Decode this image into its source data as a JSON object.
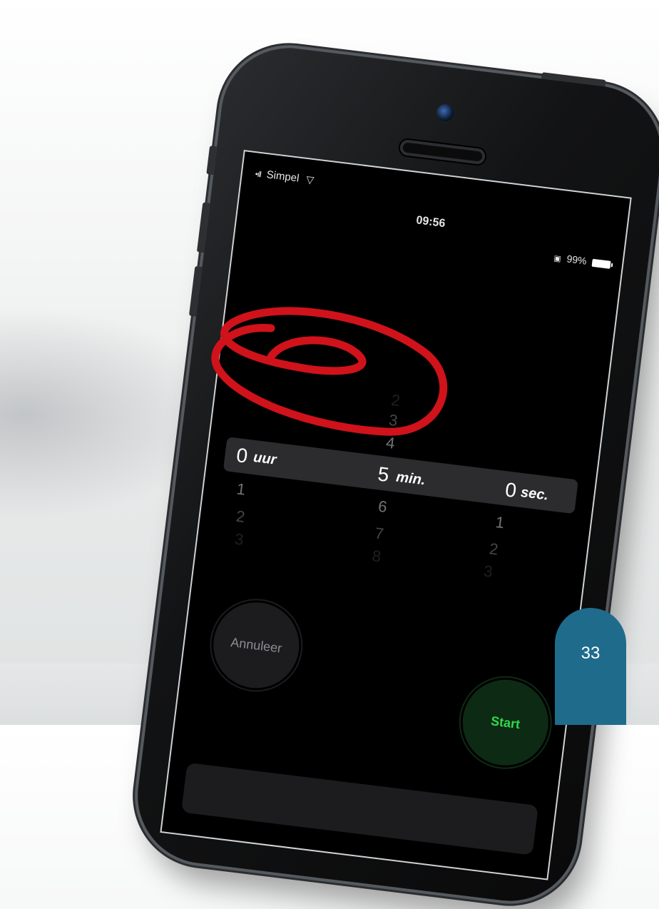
{
  "status_bar": {
    "carrier": "Simpel",
    "time": "09:56",
    "battery": "99%"
  },
  "timer_picker": {
    "hours": {
      "above": [],
      "selected": "0",
      "unit": "uur",
      "below": [
        "1",
        "2",
        "3"
      ]
    },
    "minutes": {
      "above": [
        "2",
        "3",
        "4"
      ],
      "selected": "5",
      "unit": "min.",
      "below": [
        "6",
        "7",
        "8"
      ]
    },
    "seconds": {
      "above": [],
      "selected": "0",
      "unit": "sec.",
      "below": [
        "1",
        "2",
        "3"
      ]
    }
  },
  "buttons": {
    "cancel": "Annuleer",
    "start": "Start"
  },
  "page_number": "33",
  "colors": {
    "annotation": "#d0121b",
    "start_green": "#32d74b",
    "badge": "#1f6b8c"
  },
  "icons": {
    "signal": "signal-bars-icon",
    "wifi": "wifi-icon",
    "alarm": "alarm-icon",
    "battery": "battery-icon"
  }
}
